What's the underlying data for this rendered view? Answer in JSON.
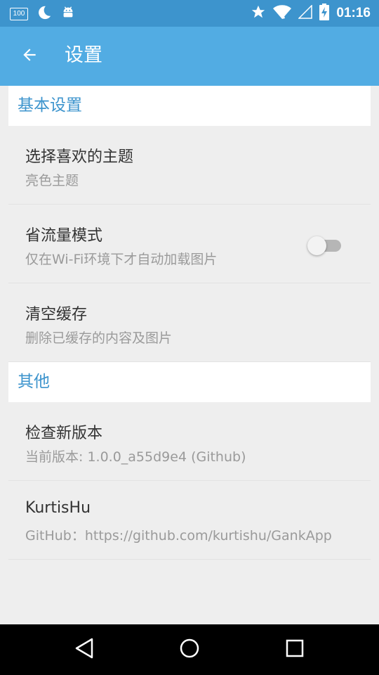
{
  "status_bar": {
    "battery_level": "100",
    "time": "01:16",
    "icons": [
      "battery-100-icon",
      "moon-icon",
      "android-icon",
      "star-icon",
      "wifi-icon",
      "cell-signal-icon",
      "battery-charging-icon"
    ]
  },
  "app_bar": {
    "title": "设置",
    "back_icon": "arrow-back-icon"
  },
  "sections": [
    {
      "header": "基本设置",
      "items": [
        {
          "title": "选择喜欢的主题",
          "summary": "亮色主题"
        },
        {
          "title": "省流量模式",
          "summary": "仅在Wi-Fi环境下才自动加载图片",
          "switch_on": false
        },
        {
          "title": "清空缓存",
          "summary": "删除已缓存的内容及图片"
        }
      ]
    },
    {
      "header": "其他",
      "items": [
        {
          "title": "检查新版本",
          "summary": "当前版本: 1.0.0_a55d9e4 (Github)"
        },
        {
          "title": "KurtisHu",
          "summary": "GitHub：https://github.com/kurtishu/GankApp"
        }
      ]
    }
  ],
  "nav_bar": {
    "back": "nav-back-icon",
    "home": "nav-home-icon",
    "recents": "nav-recents-icon"
  },
  "colors": {
    "status_bar": "#3d94cd",
    "app_bar": "#52ace3",
    "accent": "#3d94cd",
    "background": "#eeeeee"
  }
}
